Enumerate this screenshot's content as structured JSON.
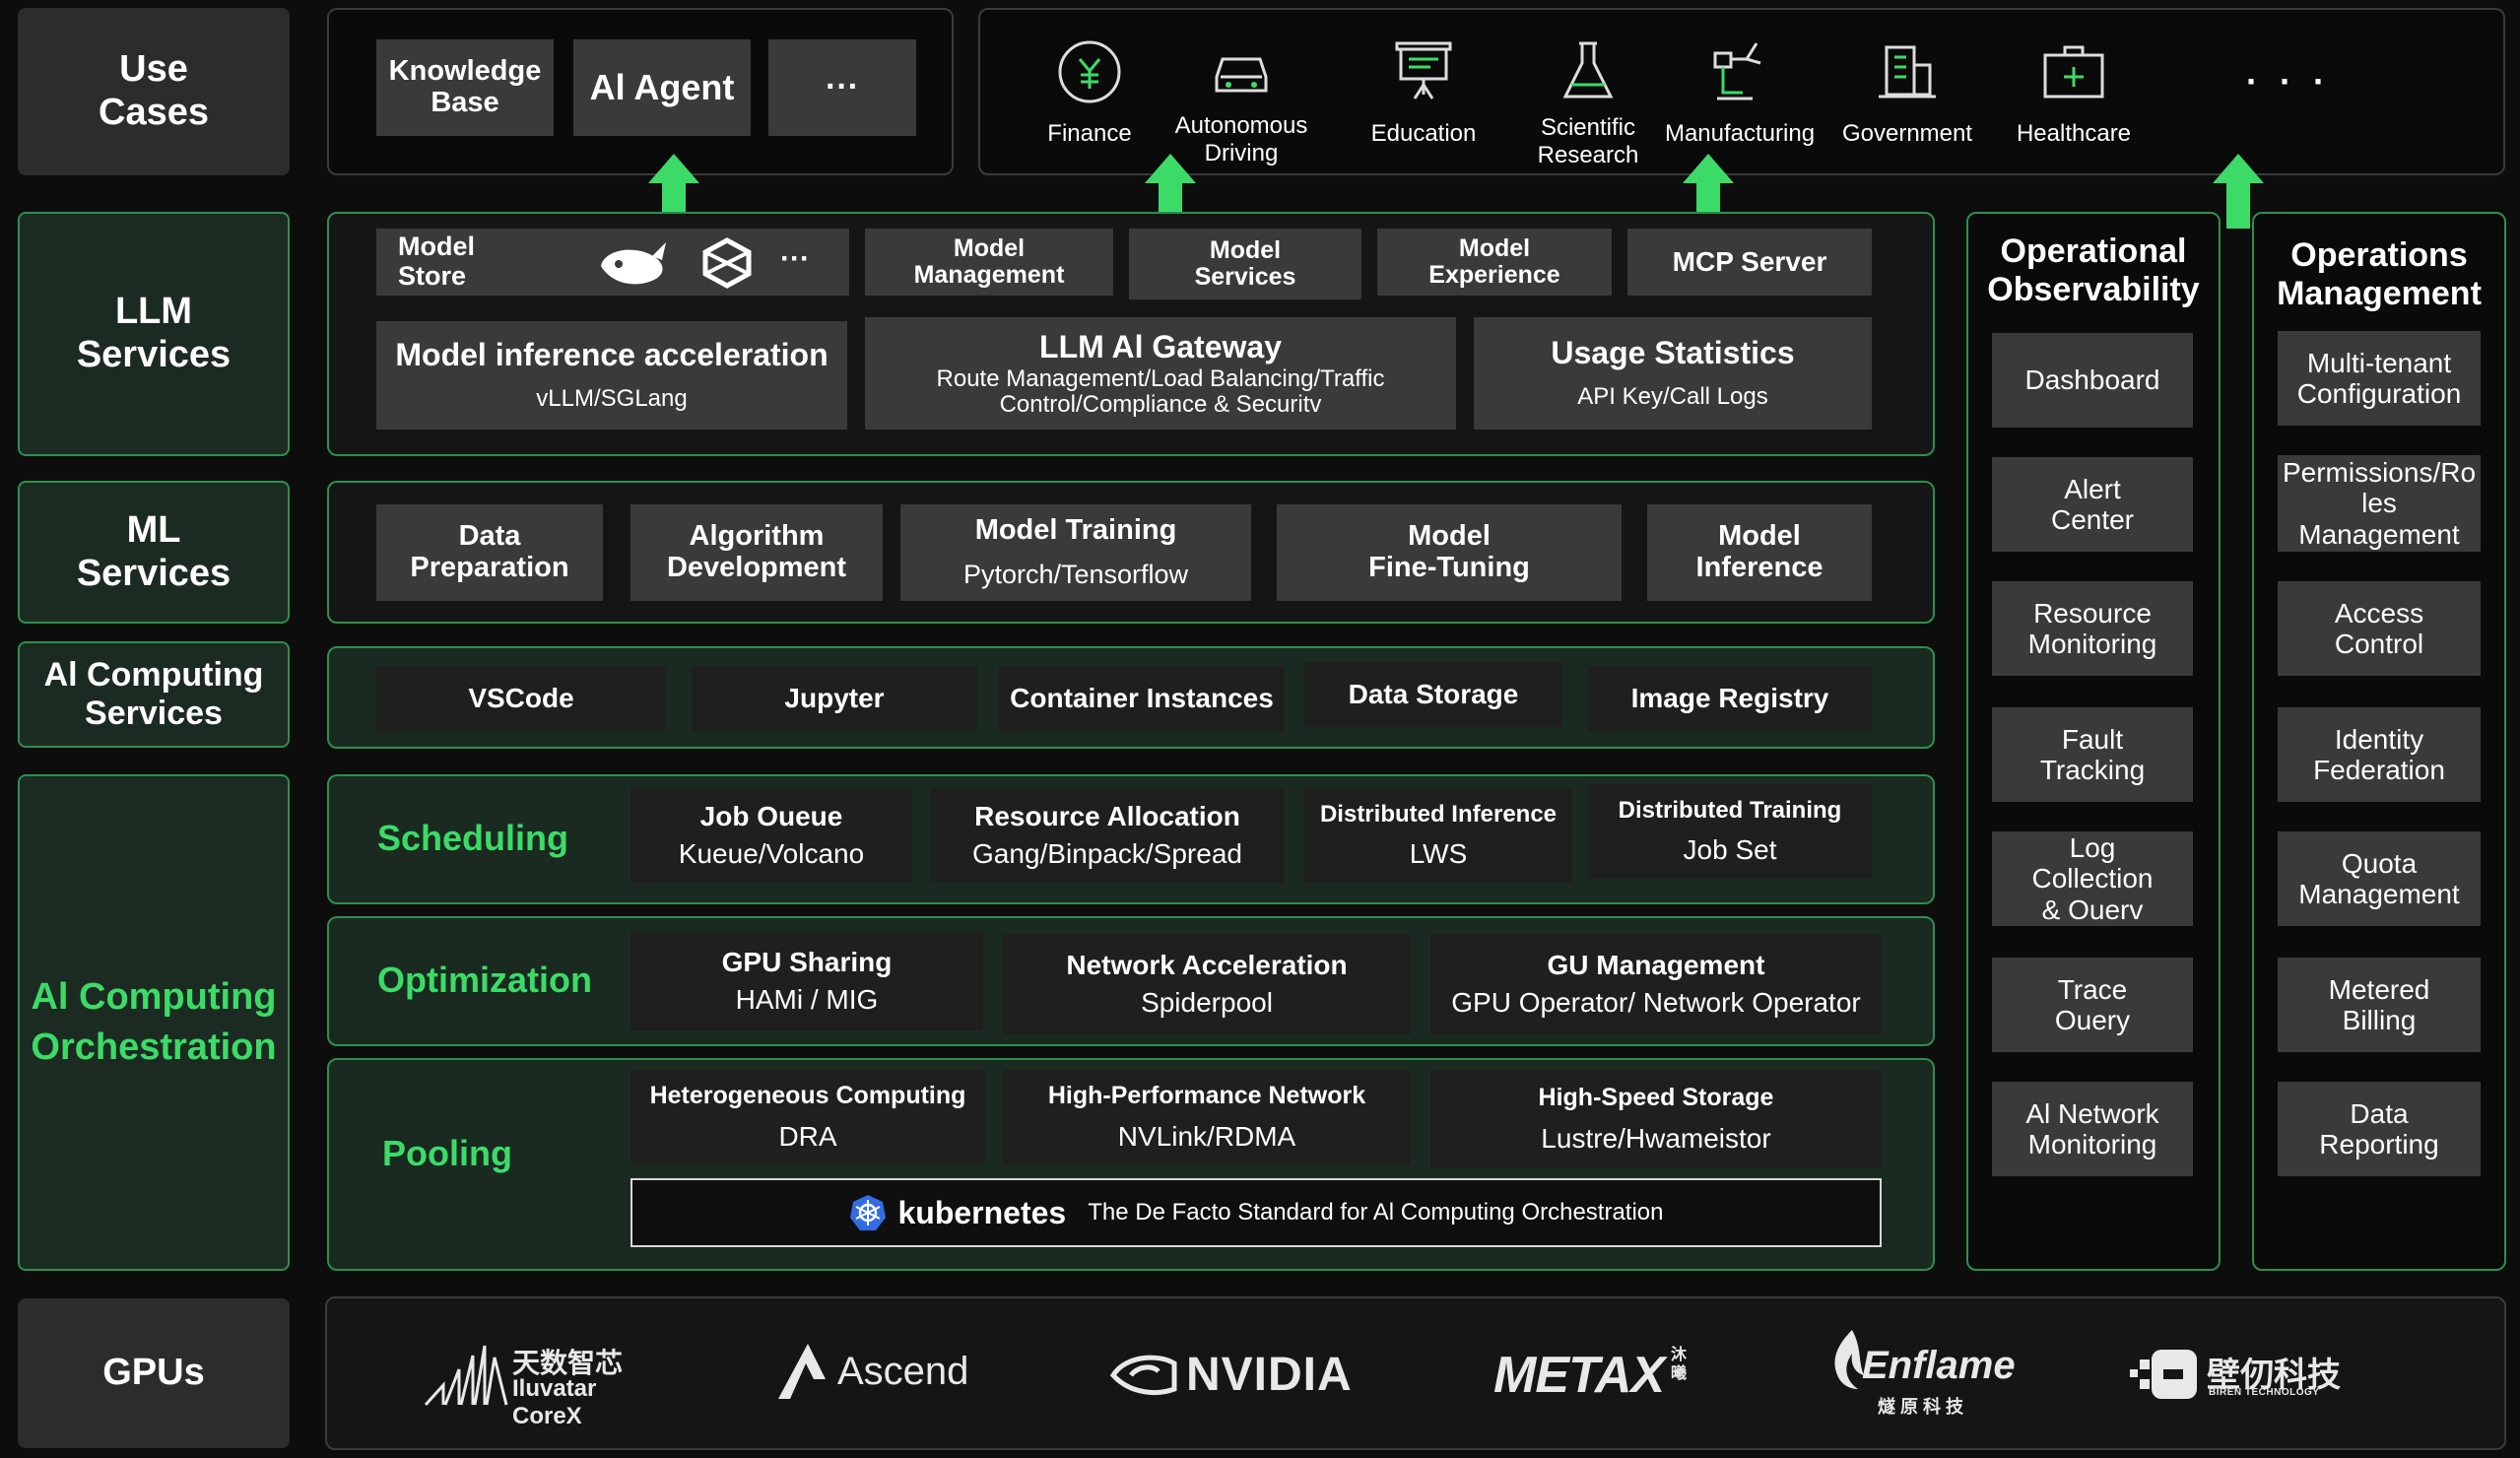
{
  "left_labels": {
    "use_cases": "Use\nCases",
    "llm_services": "LLM\nServices",
    "ml_services": "ML\nServices",
    "ai_computing_services": "Al Computing\nServices",
    "ai_computing_orchestration": "Al Computing\nOrchestration",
    "gpus": "GPUs"
  },
  "use_cases": {
    "left": [
      "Knowledge\nBase",
      "Al Agent",
      "···"
    ],
    "industries": [
      {
        "label": "Finance",
        "icon": "finance-icon"
      },
      {
        "label": "Autonomous\nDriving",
        "icon": "car-icon"
      },
      {
        "label": "Education",
        "icon": "education-icon"
      },
      {
        "label": "Scientific\nResearch",
        "icon": "flask-icon"
      },
      {
        "label": "Manufacturing",
        "icon": "manufacturing-icon"
      },
      {
        "label": "Government",
        "icon": "government-icon"
      },
      {
        "label": "Healthcare",
        "icon": "healthcare-icon"
      }
    ],
    "more": "· · ·"
  },
  "llm": {
    "model_store": "Model\nStore",
    "store_more": "···",
    "top": [
      "Model\nManagement",
      "Model\nServices",
      "Model\nExperience",
      "MCP Server"
    ],
    "inference_title": "Model inference acceleration",
    "inference_sub": "vLLM/SGLang",
    "gateway_title": "LLM Al Gateway",
    "gateway_sub": "Route Management/Load Balancing/Traffic\nControl/Compliance & Securitv",
    "usage_title": "Usage Statistics",
    "usage_sub": "API Key/Call Logs"
  },
  "ml": {
    "data_prep": "Data\nPreparation",
    "algo_dev": "Algorithm\nDevelopment",
    "training_title": "Model Training",
    "training_sub": "Pytorch/Tensorflow",
    "fine_tuning": "Model\nFine-Tuning",
    "inference": "Model\nInference"
  },
  "computing_services": [
    "VSCode",
    "Jupyter",
    "Container Instances",
    "Data Storage",
    "Image Registry"
  ],
  "scheduling": {
    "label": "Scheduling",
    "items": [
      {
        "title": "Job Oueue",
        "sub": "Kueue/Volcano"
      },
      {
        "title": "Resource Allocation",
        "sub": "Gang/Binpack/Spread"
      },
      {
        "title": "Distributed Inference",
        "sub": "LWS"
      },
      {
        "title": "Distributed Training",
        "sub": "Job Set"
      }
    ]
  },
  "optimization": {
    "label": "Optimization",
    "items": [
      {
        "title": "GPU Sharing",
        "sub": "HAMi / MIG"
      },
      {
        "title": "Network Acceleration",
        "sub": "Spiderpool"
      },
      {
        "title": "GU Management",
        "sub": "GPU Operator/ Network Operator"
      }
    ]
  },
  "pooling": {
    "label": "Pooling",
    "items": [
      {
        "title": "Heterogeneous Computing",
        "sub": "DRA"
      },
      {
        "title": "High-Performance Network",
        "sub": "NVLink/RDMA"
      },
      {
        "title": "High-Speed Storage",
        "sub": "Lustre/Hwameistor"
      }
    ],
    "k8s_name": "kubernetes",
    "k8s_desc": "The De Facto Standard for Al Computing Orchestration"
  },
  "observability": {
    "title": "Operational\nObservability",
    "items": [
      "Dashboard",
      "Alert\nCenter",
      "Resource\nMonitoring",
      "Fault\nTracking",
      "Log\nCollection\n& Ouerv",
      "Trace\nOuery",
      "Al Network\nMonitoring"
    ]
  },
  "operations": {
    "title": "Operations\nManagement",
    "items": [
      "Multi-tenant\nConfiguration",
      "Permissions/Ro\nles\nManagement",
      "Access\nControl",
      "Identity\nFederation",
      "Quota\nManagement",
      "Metered\nBilling",
      "Data\nReporting"
    ]
  },
  "gpus": {
    "iluvatar_cn": "天数智芯",
    "iluvatar": "Iluvatar CoreX",
    "ascend": "Ascend",
    "nvidia": "NVIDIA",
    "metax": "METAX",
    "metax_cn": "沐曦",
    "enflame": "Enflame",
    "enflame_cn": "燧 原 科 技",
    "biren_cn": "壁仞科技",
    "biren": "BIREN TECHNOLOGY"
  },
  "colors": {
    "accent_green": "#3cdb68",
    "border_green": "#2d8f4e",
    "box_gray": "#3a3a3a"
  }
}
